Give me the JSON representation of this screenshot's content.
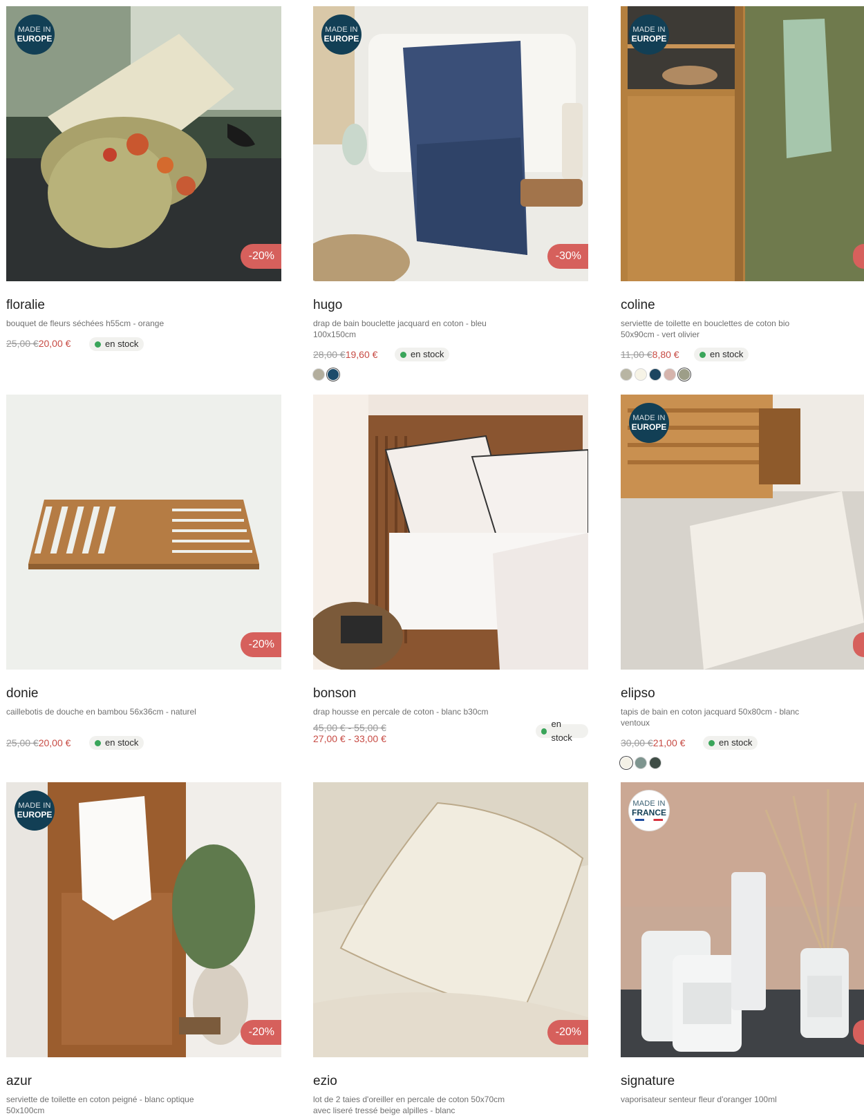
{
  "products": [
    {
      "name": "floralie",
      "desc": "bouquet de fleurs séchées h55cm - orange",
      "old_price": "25,00 €",
      "new_price": "20,00 €",
      "stock": "en stock",
      "discount": "-20%",
      "made_l1": "MADE IN",
      "made_l2": "EUROPE"
    },
    {
      "name": "hugo",
      "desc": "drap de bain bouclette jacquard en coton - bleu 100x150cm",
      "old_price": "28,00 €",
      "new_price": "19,60 €",
      "stock": "en stock",
      "discount": "-30%",
      "made_l1": "MADE IN",
      "made_l2": "EUROPE",
      "swatches": [
        "#b3ae9d",
        "#1c4b6a"
      ]
    },
    {
      "name": "coline",
      "desc": "serviette de toilette en bouclettes de coton bio 50x90cm - vert olivier",
      "old_price": "11,00 €",
      "new_price": "8,80 €",
      "stock": "en stock",
      "made_l1": "MADE IN",
      "made_l2": "EUROPE",
      "swatches": [
        "#b8b5a3",
        "#f6f3e6",
        "#1c4560",
        "#d6b4ac",
        "#9d9e88"
      ]
    },
    {
      "name": "donie",
      "desc": "caillebotis de douche en bambou 56x36cm - naturel",
      "old_price": "25,00 €",
      "new_price": "20,00 €",
      "stock": "en stock",
      "discount": "-20%"
    },
    {
      "name": "bonson",
      "desc": "drap housse en percale de coton - blanc b30cm",
      "old_price": "45,00 € - 55,00 €",
      "new_price": "27,00 € - 33,00 €",
      "stock": "en stock"
    },
    {
      "name": "elipso",
      "desc": "tapis de bain en coton jacquard 50x80cm - blanc ventoux",
      "old_price": "30,00 €",
      "new_price": "21,00 €",
      "stock": "en stock",
      "made_l1": "MADE IN",
      "made_l2": "EUROPE",
      "swatches": [
        "#f4f1e6",
        "#7e958f",
        "#3f4d46"
      ]
    },
    {
      "name": "azur",
      "desc": "serviette de toilette en coton peigné - blanc optique 50x100cm",
      "discount": "-20%",
      "made_l1": "MADE IN",
      "made_l2": "EUROPE"
    },
    {
      "name": "ezio",
      "desc": "lot de 2 taies d'oreiller en percale de coton 50x70cm avec liseré tressé beige alpilles - blanc",
      "discount": "-20%"
    },
    {
      "name": "signature",
      "desc": "vaporisateur senteur fleur d'oranger 100ml",
      "made_l1": "MADE IN",
      "made_l2": "FRANCE"
    }
  ]
}
